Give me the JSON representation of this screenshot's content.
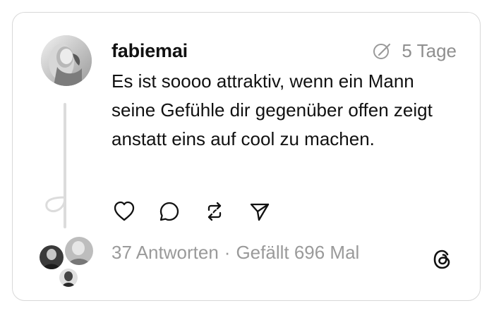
{
  "post": {
    "username": "fabiemai",
    "time": "5 Tage",
    "text": "Es ist soooo attraktiv, wenn ein Mann seine Gefühle dir gegenüber offen zeigt anstatt eins auf cool zu machen.",
    "replies": "37 Antworten",
    "separator": "·",
    "likes": "Gefällt 696 Mal"
  },
  "icons": {
    "edit": "pencil-circle-icon",
    "like": "heart-icon",
    "reply": "comment-icon",
    "repost": "repost-icon",
    "share": "send-icon",
    "brand": "threads-logo-icon"
  },
  "colors": {
    "text": "#111111",
    "muted": "#9a9a9a",
    "border": "#d8d8d8",
    "line": "#dcdcdc"
  }
}
